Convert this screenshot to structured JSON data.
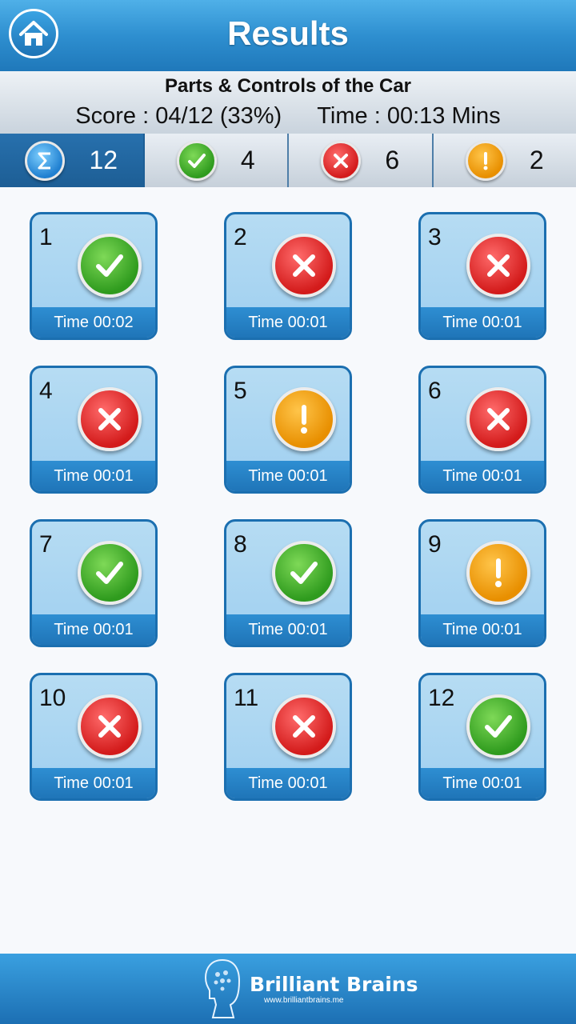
{
  "header": {
    "title": "Results"
  },
  "summary": {
    "quiz_name": "Parts & Controls of the Car",
    "score": "Score : 04/12 (33%)",
    "time": "Time : 00:13 Mins"
  },
  "tabs": [
    {
      "icon": "sigma-icon",
      "count": "12",
      "color": "#1f7fd0"
    },
    {
      "icon": "check-icon",
      "count": "4",
      "color": "#2f9b1e"
    },
    {
      "icon": "cross-icon",
      "count": "6",
      "color": "#d31b1b"
    },
    {
      "icon": "exclamation-icon",
      "count": "2",
      "color": "#e88f00"
    }
  ],
  "questions": [
    {
      "number": "1",
      "status": "correct",
      "time": "Time 00:02"
    },
    {
      "number": "2",
      "status": "wrong",
      "time": "Time 00:01"
    },
    {
      "number": "3",
      "status": "wrong",
      "time": "Time 00:01"
    },
    {
      "number": "4",
      "status": "wrong",
      "time": "Time 00:01"
    },
    {
      "number": "5",
      "status": "skipped",
      "time": "Time 00:01"
    },
    {
      "number": "6",
      "status": "wrong",
      "time": "Time 00:01"
    },
    {
      "number": "7",
      "status": "correct",
      "time": "Time 00:01"
    },
    {
      "number": "8",
      "status": "correct",
      "time": "Time 00:01"
    },
    {
      "number": "9",
      "status": "skipped",
      "time": "Time 00:01"
    },
    {
      "number": "10",
      "status": "wrong",
      "time": "Time 00:01"
    },
    {
      "number": "11",
      "status": "wrong",
      "time": "Time 00:01"
    },
    {
      "number": "12",
      "status": "correct",
      "time": "Time 00:01"
    }
  ],
  "footer": {
    "brand": "Brilliant Brains",
    "url": "www.brilliantbrains.me"
  }
}
